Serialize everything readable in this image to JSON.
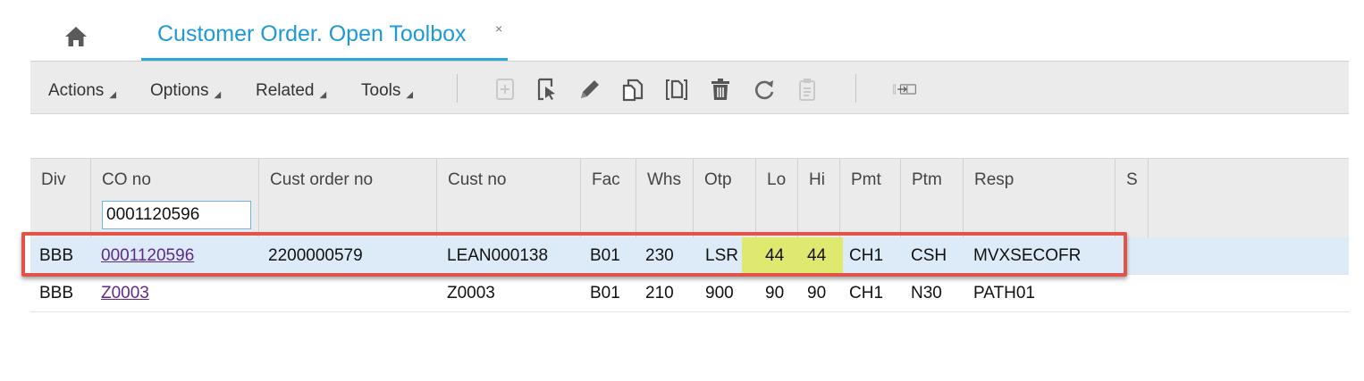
{
  "tabs": {
    "home_icon": "home-icon",
    "active_label": "Customer Order. Open Toolbox",
    "close_glyph": "×"
  },
  "toolbar": {
    "menus": [
      {
        "label": "Actions"
      },
      {
        "label": "Options"
      },
      {
        "label": "Related"
      },
      {
        "label": "Tools"
      }
    ],
    "icons": [
      "new-icon",
      "select-icon",
      "edit-icon",
      "copy-icon",
      "duplicate-icon",
      "delete-icon",
      "refresh-icon",
      "notes-icon",
      "export-icon"
    ]
  },
  "grid": {
    "columns": [
      {
        "label": "Div"
      },
      {
        "label": "CO no"
      },
      {
        "label": "Cust order no"
      },
      {
        "label": "Cust no"
      },
      {
        "label": "Fac"
      },
      {
        "label": "Whs"
      },
      {
        "label": "Otp"
      },
      {
        "label": "Lo"
      },
      {
        "label": "Hi"
      },
      {
        "label": "Pmt"
      },
      {
        "label": "Ptm"
      },
      {
        "label": "Resp"
      },
      {
        "label": "S"
      }
    ],
    "filter": {
      "co_no": "0001120596"
    },
    "rows": [
      {
        "div": "BBB",
        "co_no": "0001120596",
        "cust_order_no": "2200000579",
        "cust_no": "LEAN000138",
        "fac": "B01",
        "whs": "230",
        "otp": "LSR",
        "lo": "44",
        "hi": "44",
        "pmt": "CH1",
        "ptm": "CSH",
        "resp": "MVXSECOFR",
        "s": ""
      },
      {
        "div": "BBB",
        "co_no": "Z0003",
        "cust_order_no": "",
        "cust_no": "Z0003",
        "fac": "B01",
        "whs": "210",
        "otp": "900",
        "lo": "90",
        "hi": "90",
        "pmt": "CH1",
        "ptm": "N30",
        "resp": "PATH01",
        "s": ""
      }
    ]
  },
  "colors": {
    "accent": "#1d9ad6",
    "highlight_border": "#e2534a",
    "lohi_highlight": "#dfe86f",
    "selected_row": "#dcebf7",
    "link": "#5d2a8c"
  }
}
